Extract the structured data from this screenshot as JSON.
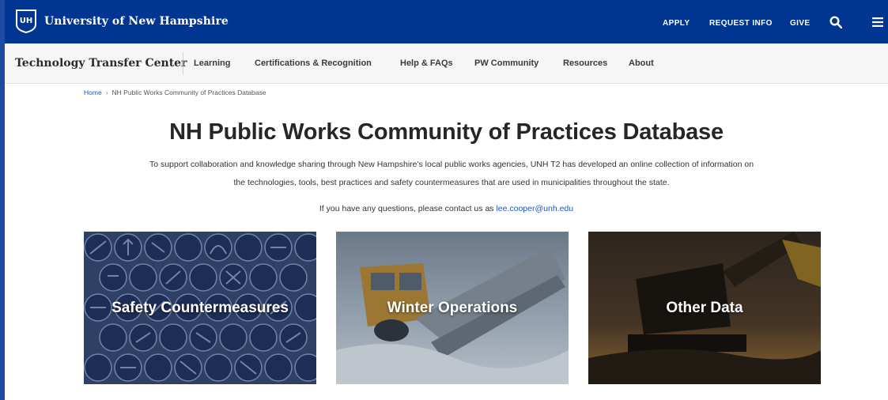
{
  "topbar": {
    "university_name": "University of New Hampshire",
    "links": [
      "APPLY",
      "REQUEST INFO",
      "GIVE"
    ],
    "icons": [
      "unh-logo",
      "search-icon",
      "menu-icon"
    ],
    "background": "#003591"
  },
  "subnav": {
    "site_title": "Technology Transfer Center",
    "items": [
      "Learning",
      "Certifications & Recognition",
      "Help & FAQs",
      "PW Community",
      "Resources",
      "About"
    ]
  },
  "breadcrumb": {
    "home": "Home",
    "separator": "›",
    "current": "NH Public Works Community of Practices Database"
  },
  "main": {
    "title": "NH Public Works Community of Practices Database",
    "intro_line1": "To support collaboration and knowledge sharing through New Hampshire's local public works agencies, UNH T2 has developed an online collection of information on",
    "intro_line2": "the technologies, tools, best practices and safety countermeasures that are used in municipalities throughout the state.",
    "contact_text": "If you have any questions, please contact us as ",
    "contact_email": "lee.cooper@unh.edu"
  },
  "cards": [
    {
      "label": "Safety Countermeasures"
    },
    {
      "label": "Winter Operations"
    },
    {
      "label": "Other Data"
    }
  ],
  "colors": {
    "frame": "#1d4aa3",
    "link": "#1e56c2",
    "accent": "#003591"
  }
}
